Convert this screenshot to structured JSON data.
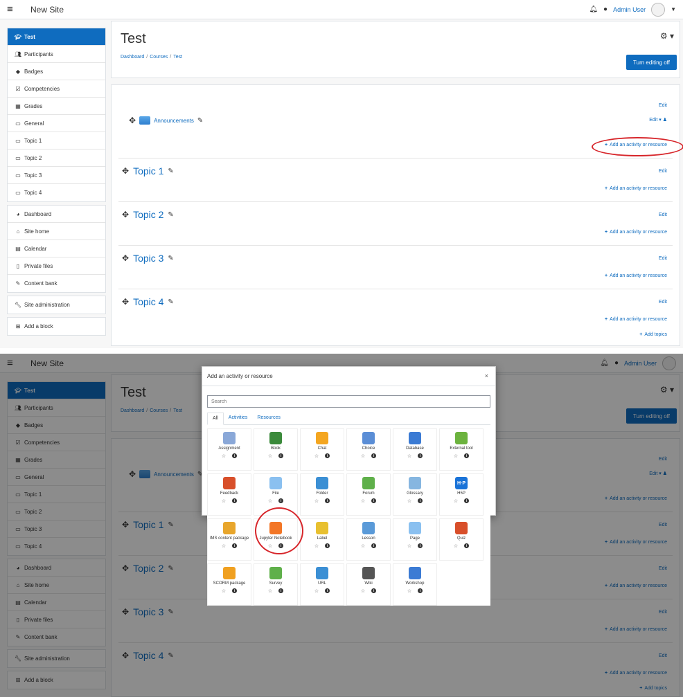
{
  "site_name": "New Site",
  "user_name": "Admin User",
  "course": {
    "title": "Test",
    "breadcrumb": [
      "Dashboard",
      "Courses",
      "Test"
    ],
    "edit_button": "Turn editing off"
  },
  "sidebar": {
    "course_items": [
      {
        "label": "Test",
        "icon": "graduation-cap"
      },
      {
        "label": "Participants",
        "icon": "users"
      },
      {
        "label": "Badges",
        "icon": "shield"
      },
      {
        "label": "Competencies",
        "icon": "check-square"
      },
      {
        "label": "Grades",
        "icon": "table"
      },
      {
        "label": "General",
        "icon": "folder"
      },
      {
        "label": "Topic 1",
        "icon": "folder"
      },
      {
        "label": "Topic 2",
        "icon": "folder"
      },
      {
        "label": "Topic 3",
        "icon": "folder"
      },
      {
        "label": "Topic 4",
        "icon": "folder"
      }
    ],
    "site_items": [
      {
        "label": "Dashboard",
        "icon": "tachometer"
      },
      {
        "label": "Site home",
        "icon": "home"
      },
      {
        "label": "Calendar",
        "icon": "calendar"
      },
      {
        "label": "Private files",
        "icon": "file"
      },
      {
        "label": "Content bank",
        "icon": "paint-brush"
      }
    ],
    "admin_item": {
      "label": "Site administration",
      "icon": "wrench"
    },
    "block_item": {
      "label": "Add a block",
      "icon": "plus-square"
    }
  },
  "sections": {
    "edit_label": "Edit",
    "add_label": "Add an activity or resource",
    "announcements": "Announcements",
    "topics": [
      "Topic 1",
      "Topic 2",
      "Topic 3",
      "Topic 4"
    ],
    "add_topics": "Add topics"
  },
  "modal": {
    "title": "Add an activity or resource",
    "close": "×",
    "search_placeholder": "Search",
    "tabs": [
      "All",
      "Activities",
      "Resources"
    ],
    "modules": [
      {
        "label": "Assignment",
        "icon": "assignment-icon",
        "color": "#8aa8d8"
      },
      {
        "label": "Book",
        "icon": "book-icon",
        "color": "#3b8a3b"
      },
      {
        "label": "Chat",
        "icon": "chat-icon",
        "color": "#f4a620"
      },
      {
        "label": "Choice",
        "icon": "choice-icon",
        "color": "#5b8ed6"
      },
      {
        "label": "Database",
        "icon": "database-icon",
        "color": "#3b7bd4"
      },
      {
        "label": "External tool",
        "icon": "puzzle-icon",
        "color": "#6cb33e"
      },
      {
        "label": "Feedback",
        "icon": "megaphone-icon",
        "color": "#d84f2a"
      },
      {
        "label": "File",
        "icon": "file-icon",
        "color": "#8ac0f0"
      },
      {
        "label": "Folder",
        "icon": "folder-icon",
        "color": "#3b8fd4"
      },
      {
        "label": "Forum",
        "icon": "forum-icon",
        "color": "#5fb04a"
      },
      {
        "label": "Glossary",
        "icon": "glossary-icon",
        "color": "#86b6e0"
      },
      {
        "label": "H5P",
        "icon": "h5p-icon",
        "color": "#1a73d8",
        "text": "H·P"
      },
      {
        "label": "IMS content package",
        "icon": "package-icon",
        "color": "#e8a62c"
      },
      {
        "label": "Jupyter Notebook",
        "icon": "jupyter-icon",
        "color": "#f37626"
      },
      {
        "label": "Label",
        "icon": "label-icon",
        "color": "#e8c030"
      },
      {
        "label": "Lesson",
        "icon": "lesson-icon",
        "color": "#5a9ad8"
      },
      {
        "label": "Page",
        "icon": "page-icon",
        "color": "#8ac0f0"
      },
      {
        "label": "Quiz",
        "icon": "quiz-icon",
        "color": "#d84f2a"
      },
      {
        "label": "SCORM package",
        "icon": "scorm-icon",
        "color": "#f0a020"
      },
      {
        "label": "Survey",
        "icon": "survey-icon",
        "color": "#5fb04a"
      },
      {
        "label": "URL",
        "icon": "url-icon",
        "color": "#3b8fd4"
      },
      {
        "label": "Wiki",
        "icon": "wiki-icon",
        "color": "#555555"
      },
      {
        "label": "Workshop",
        "icon": "workshop-icon",
        "color": "#3b7bd4"
      }
    ]
  },
  "colors": {
    "accent": "#0f6cbf",
    "highlight_circle": "#d7262b"
  }
}
